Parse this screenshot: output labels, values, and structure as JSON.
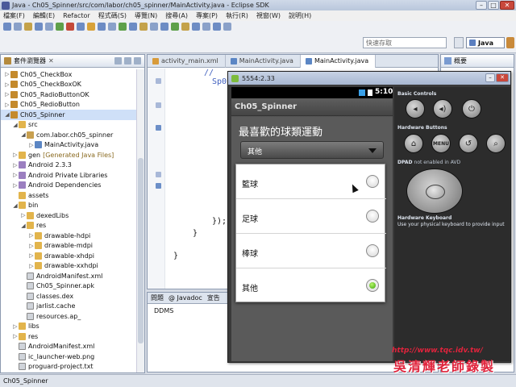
{
  "window": {
    "title": "Java - Ch05_Spinner/src/com/labor/ch05_spinner/MainActivity.java - Eclipse SDK"
  },
  "menu": [
    "檔案(F)",
    "編輯(E)",
    "Refactor",
    "程式碼(S)",
    "導覽(N)",
    "搜尋(A)",
    "專案(P)",
    "執行(R)",
    "視窗(W)",
    "說明(H)"
  ],
  "toolbar": {
    "quick_access": "快速存取",
    "perspective_java": "Java"
  },
  "package_explorer": {
    "title": "套件瀏覽器",
    "items": [
      {
        "label": "Ch05_CheckBox",
        "indent": 0,
        "icon": "project-icon",
        "arrow": "▷"
      },
      {
        "label": "Ch05_CheckBoxOK",
        "indent": 0,
        "icon": "project-icon",
        "arrow": "▷"
      },
      {
        "label": "Ch05_RadioButtonOK",
        "indent": 0,
        "icon": "project-icon",
        "arrow": "▷"
      },
      {
        "label": "Ch05_RedioButton",
        "indent": 0,
        "icon": "project-icon",
        "arrow": "▷"
      },
      {
        "label": "Ch05_Spinner",
        "indent": 0,
        "icon": "project-icon",
        "arrow": "◢",
        "selected": true
      },
      {
        "label": "src",
        "indent": 1,
        "icon": "folder-icon",
        "arrow": "◢"
      },
      {
        "label": "com.labor.ch05_spinner",
        "indent": 2,
        "icon": "package-icon",
        "arrow": "◢"
      },
      {
        "label": "MainActivity.java",
        "indent": 3,
        "icon": "java-file-icon",
        "arrow": "▷"
      },
      {
        "label": "gen",
        "sub": "[Generated Java Files]",
        "indent": 1,
        "icon": "folder-icon",
        "arrow": "▷"
      },
      {
        "label": "Android 2.3.3",
        "indent": 1,
        "icon": "library-icon",
        "arrow": "▷"
      },
      {
        "label": "Android Private Libraries",
        "indent": 1,
        "icon": "library-icon",
        "arrow": "▷"
      },
      {
        "label": "Android Dependencies",
        "indent": 1,
        "icon": "library-icon",
        "arrow": "▷"
      },
      {
        "label": "assets",
        "indent": 1,
        "icon": "folder-icon",
        "arrow": ""
      },
      {
        "label": "bin",
        "indent": 1,
        "icon": "folder-icon",
        "arrow": "◢"
      },
      {
        "label": "dexedLibs",
        "indent": 2,
        "icon": "folder-icon",
        "arrow": "▷"
      },
      {
        "label": "res",
        "indent": 2,
        "icon": "folder-icon",
        "arrow": "◢"
      },
      {
        "label": "drawable-hdpi",
        "indent": 3,
        "icon": "folder-icon",
        "arrow": "▷"
      },
      {
        "label": "drawable-mdpi",
        "indent": 3,
        "icon": "folder-icon",
        "arrow": "▷"
      },
      {
        "label": "drawable-xhdpi",
        "indent": 3,
        "icon": "folder-icon",
        "arrow": "▷"
      },
      {
        "label": "drawable-xxhdpi",
        "indent": 3,
        "icon": "folder-icon",
        "arrow": "▷"
      },
      {
        "label": "AndroidManifest.xml",
        "indent": 2,
        "icon": "file-icon",
        "arrow": ""
      },
      {
        "label": "Ch05_Spinner.apk",
        "indent": 2,
        "icon": "file-icon",
        "arrow": ""
      },
      {
        "label": "classes.dex",
        "indent": 2,
        "icon": "file-icon",
        "arrow": ""
      },
      {
        "label": "jarlist.cache",
        "indent": 2,
        "icon": "file-icon",
        "arrow": ""
      },
      {
        "label": "resources.ap_",
        "indent": 2,
        "icon": "file-icon",
        "arrow": ""
      },
      {
        "label": "libs",
        "indent": 1,
        "icon": "folder-icon",
        "arrow": "▷"
      },
      {
        "label": "res",
        "indent": 1,
        "icon": "folder-icon",
        "arrow": "▷"
      },
      {
        "label": "AndroidManifest.xml",
        "indent": 1,
        "icon": "file-icon",
        "arrow": ""
      },
      {
        "label": "ic_launcher-web.png",
        "indent": 1,
        "icon": "file-icon",
        "arrow": ""
      },
      {
        "label": "proguard-project.txt",
        "indent": 1,
        "icon": "file-icon",
        "arrow": ""
      }
    ]
  },
  "editor": {
    "tabs": [
      {
        "label": "activity_main.xml",
        "active": false
      },
      {
        "label": "MainActivity.java",
        "active": false
      },
      {
        "label": "MainActivity.java",
        "active": true
      }
    ],
    "code_lines": [
      {
        "text": "//",
        "blue": true
      },
      {
        "text": "Sp0",
        "blue": true
      },
      {
        "text": "});",
        "blue": false
      },
      {
        "text": "}",
        "blue": false
      },
      {
        "text": "}",
        "blue": false
      }
    ]
  },
  "bottom_panel": {
    "tabs": [
      "問題",
      "@ Javadoc",
      "宣告"
    ],
    "ddms_label": "DDMS"
  },
  "outline": {
    "title": "概要"
  },
  "emulator": {
    "title": "5554:2.33",
    "time": "5:10",
    "app_title": "Ch05_Spinner",
    "question": "最喜歡的球類運動",
    "spinner_value": "其他",
    "options": [
      {
        "label": "籃球",
        "checked": false
      },
      {
        "label": "足球",
        "checked": false
      },
      {
        "label": "棒球",
        "checked": false
      },
      {
        "label": "其他",
        "checked": true
      }
    ],
    "controls": {
      "basic_controls": "Basic Controls",
      "hardware_buttons": "Hardware Buttons",
      "menu_label": "MENU",
      "dpad_label": "DPAD",
      "dpad_note": "not enabled in AVD",
      "keyboard_label": "Hardware Keyboard",
      "keyboard_note": "Use your physical keyboard to provide input"
    }
  },
  "watermark": {
    "url": "http://www.tqc.idv.tw/",
    "name": "吳清輝老師錄製"
  },
  "status_bar": {
    "text": "Ch05_Spinner"
  },
  "colors": {
    "accent_blue": "#3f5fbf",
    "radio_green": "#3aa30a",
    "watermark_red": "#e0233c"
  }
}
